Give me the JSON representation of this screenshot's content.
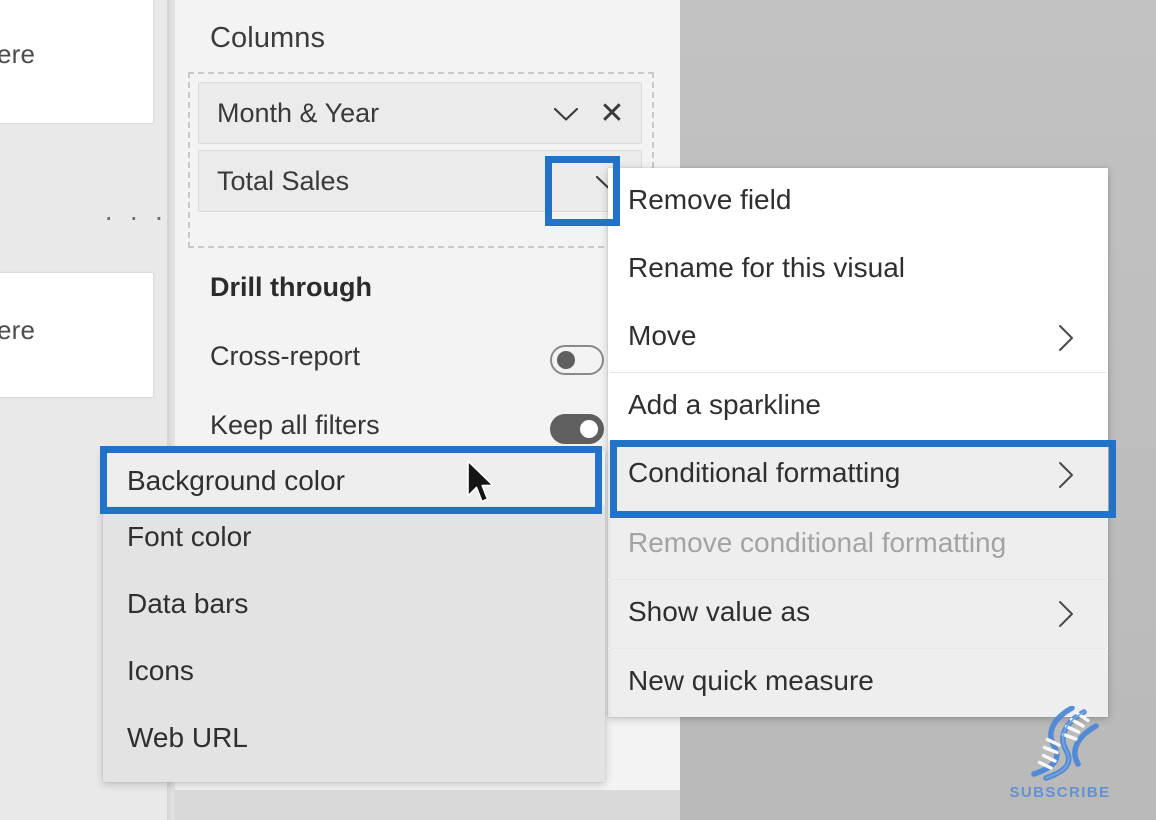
{
  "app": {
    "context": "Power BI field well context menu"
  },
  "canvas": {
    "card_top_text": "ere",
    "card_bottom_text": "ere",
    "ellipsis": "· · ·"
  },
  "fields_pane": {
    "title": "Columns",
    "chips": [
      {
        "label": "Month & Year",
        "has_chevron": true,
        "has_close": true
      },
      {
        "label": "Total Sales",
        "has_chevron": true,
        "has_close": false
      }
    ],
    "options": [
      {
        "label": "Drill through",
        "bold": true,
        "toggle": null
      },
      {
        "label": "Cross-report",
        "bold": false,
        "toggle": "off"
      },
      {
        "label": "Keep all filters",
        "bold": false,
        "toggle": "on"
      }
    ]
  },
  "context_menu": {
    "items": [
      {
        "label": "Remove field",
        "arrow": false,
        "disabled": false,
        "shaded": false
      },
      {
        "label": "Rename for this visual",
        "arrow": false,
        "disabled": false,
        "shaded": false
      },
      {
        "label": "Move",
        "arrow": true,
        "disabled": false,
        "shaded": false
      },
      {
        "label": "Add a sparkline",
        "arrow": false,
        "disabled": false,
        "shaded": false
      },
      {
        "label": "Conditional formatting",
        "arrow": true,
        "disabled": false,
        "shaded": true
      },
      {
        "label": "Remove conditional formatting",
        "arrow": false,
        "disabled": true,
        "shaded": true
      },
      {
        "label": "Show value as",
        "arrow": true,
        "disabled": false,
        "shaded": true
      },
      {
        "label": "New quick measure",
        "arrow": false,
        "disabled": false,
        "shaded": true
      }
    ]
  },
  "submenu": {
    "items": [
      {
        "label": "Background color",
        "highlighted": true
      },
      {
        "label": "Font color",
        "highlighted": false
      },
      {
        "label": "Data bars",
        "highlighted": false
      },
      {
        "label": "Icons",
        "highlighted": false
      },
      {
        "label": "Web URL",
        "highlighted": false
      }
    ]
  },
  "watermark": {
    "text": "SUBSCRIBE",
    "icon": "dna-helix-icon"
  },
  "colors": {
    "highlight_blue": "#2272c8",
    "menu_white": "#ffffff",
    "menu_grey": "#e3e3e3",
    "pane_grey": "#f3f3f3",
    "canvas_grey": "#bcbcbc",
    "watermark_blue": "#5b8fd6"
  }
}
